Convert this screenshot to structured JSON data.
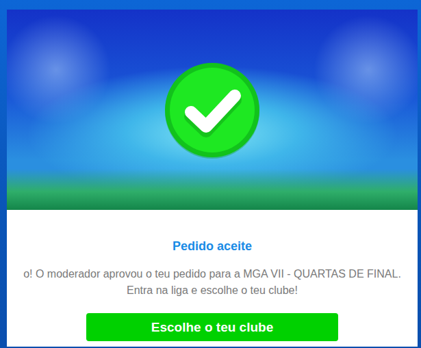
{
  "dialog": {
    "title": "Pedido aceite",
    "message": "o! O moderador aprovou o teu pedido para a MGA VII - QUARTAS DE FINAL. Entra na liga e escolhe o teu clube!",
    "button": "Escolhe o teu clube"
  }
}
